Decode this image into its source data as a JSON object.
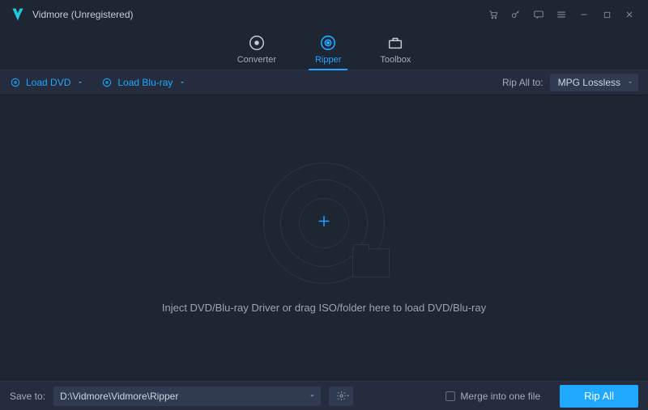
{
  "window": {
    "title": "Vidmore (Unregistered)"
  },
  "tabs": {
    "converter": "Converter",
    "ripper": "Ripper",
    "toolbox": "Toolbox"
  },
  "toolbar": {
    "load_dvd": "Load DVD",
    "load_bluray": "Load Blu-ray",
    "rip_all_to": "Rip All to:",
    "format": "MPG Lossless"
  },
  "main": {
    "hint": "Inject DVD/Blu-ray Driver or drag ISO/folder here to load DVD/Blu-ray"
  },
  "footer": {
    "save_to_label": "Save to:",
    "save_to_path": "D:\\Vidmore\\Vidmore\\Ripper",
    "merge_label": "Merge into one file",
    "rip_button": "Rip All"
  },
  "colors": {
    "accent": "#1ea8ff"
  }
}
